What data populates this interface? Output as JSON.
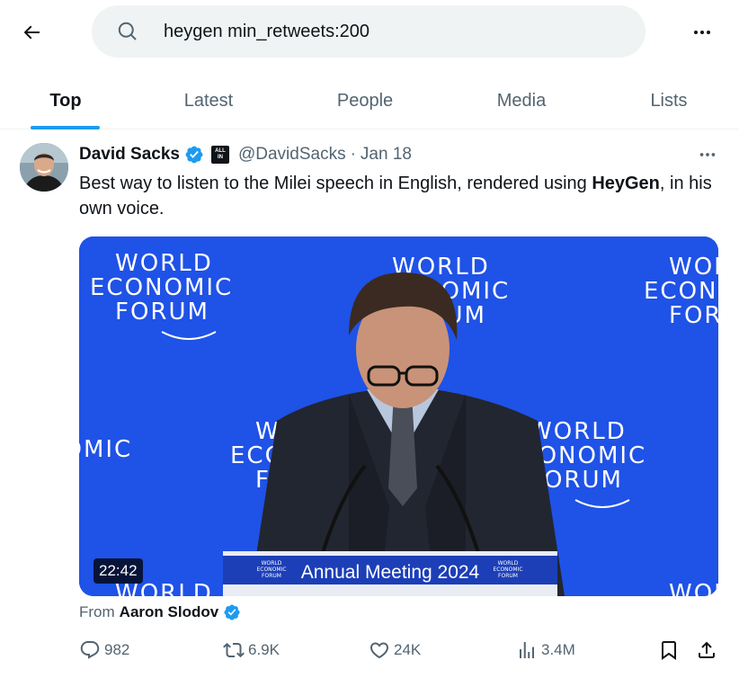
{
  "search": {
    "query": "heygen min_retweets:200"
  },
  "tabs": [
    {
      "label": "Top",
      "active": true
    },
    {
      "label": "Latest",
      "active": false
    },
    {
      "label": "People",
      "active": false
    },
    {
      "label": "Media",
      "active": false
    },
    {
      "label": "Lists",
      "active": false
    }
  ],
  "tweet": {
    "author": {
      "name": "David Sacks",
      "handle": "@DavidSacks",
      "affiliate_badge": "ALL IN"
    },
    "separator": "·",
    "date": "Jan 18",
    "text_before": "Best way to listen to the Milei speech in English, rendered using ",
    "text_bold": "HeyGen",
    "text_after": ", in his own voice.",
    "video": {
      "duration": "22:42",
      "backdrop_logo_lines": [
        "WORLD",
        "ECONOMIC",
        "FORUM"
      ],
      "podium_logo_lines": [
        "WORLD",
        "ECONOMIC",
        "FORUM"
      ],
      "podium_text": "Annual Meeting 2024"
    },
    "from": {
      "prefix": "From",
      "name": "Aaron Slodov"
    },
    "stats": {
      "replies": "982",
      "reposts": "6.9K",
      "likes": "24K",
      "views": "3.4M"
    }
  },
  "colors": {
    "accent": "#1d9bf0",
    "text": "#0f1419",
    "muted": "#536471",
    "search_bg": "#eff3f4",
    "video_bg": "#1f52e6"
  },
  "icons": [
    "back-arrow-icon",
    "search-icon",
    "more-icon",
    "verified-icon",
    "reply-icon",
    "repost-icon",
    "like-icon",
    "views-icon",
    "bookmark-icon",
    "share-icon"
  ]
}
